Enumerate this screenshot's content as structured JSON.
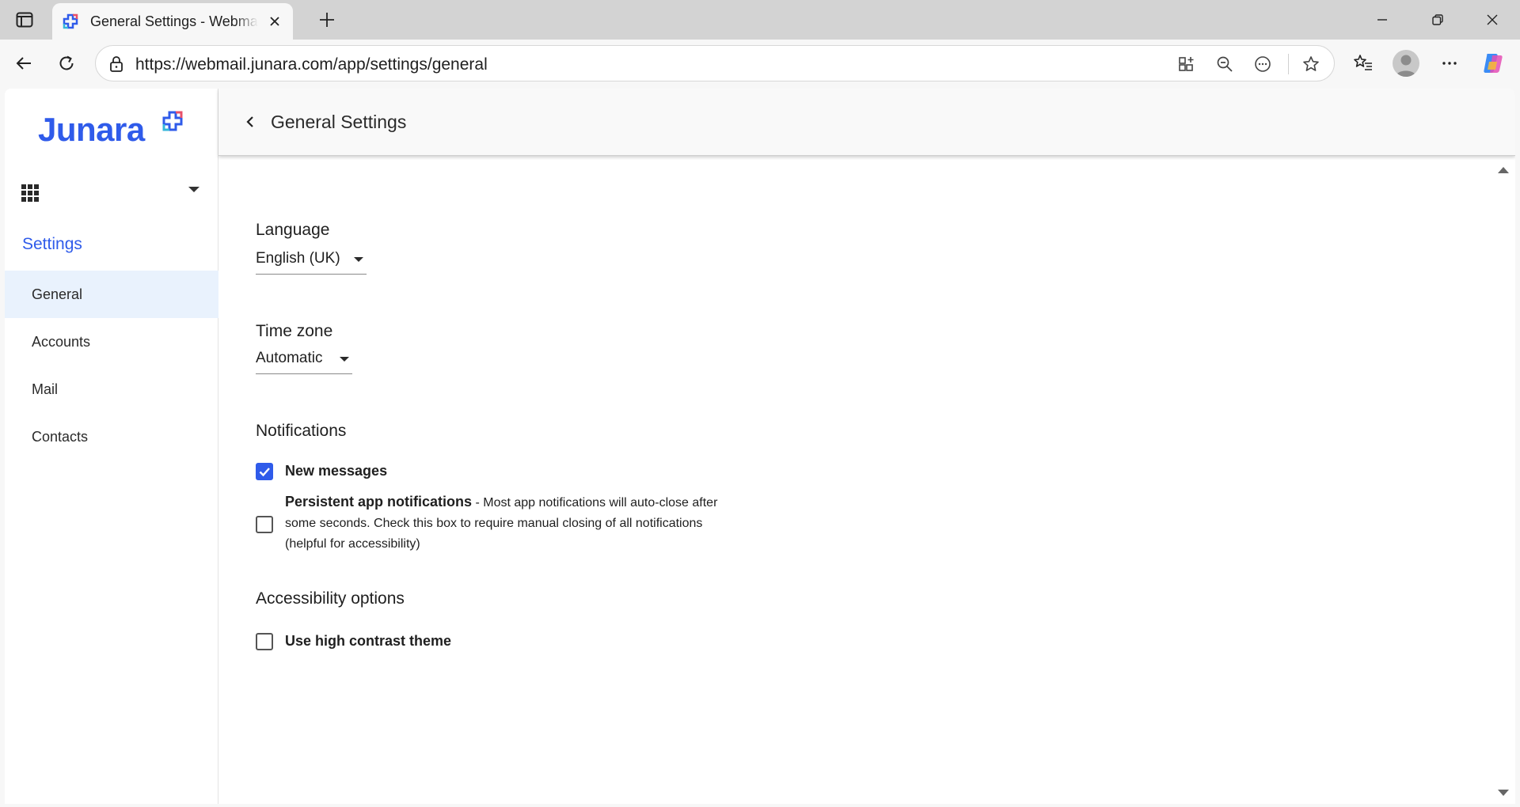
{
  "browser": {
    "tab_title": "General Settings - Webmail",
    "url": "https://webmail.junara.com/app/settings/general"
  },
  "sidebar": {
    "logo_text": "Junara",
    "settings_heading": "Settings",
    "items": [
      {
        "label": "General",
        "active": true
      },
      {
        "label": "Accounts",
        "active": false
      },
      {
        "label": "Mail",
        "active": false
      },
      {
        "label": "Contacts",
        "active": false
      }
    ]
  },
  "header": {
    "title": "General Settings"
  },
  "settings": {
    "language": {
      "label": "Language",
      "value": "English (UK)"
    },
    "timezone": {
      "label": "Time zone",
      "value": "Automatic"
    },
    "notifications": {
      "label": "Notifications",
      "new_messages": {
        "label": "New messages",
        "checked": true
      },
      "persistent": {
        "label": "Persistent app notifications",
        "description": " - Most app notifications will auto-close after some seconds. Check this box to require manual closing of all notifications (helpful for accessibility)",
        "checked": false
      }
    },
    "accessibility": {
      "label": "Accessibility options",
      "high_contrast": {
        "label": "Use high contrast theme",
        "checked": false
      }
    }
  },
  "colors": {
    "accent": "#2f5bea",
    "active_nav_bg": "#e9f2fd",
    "tabstrip_bg": "#d3d3d3"
  },
  "icons": {
    "tab_actions": "tab-actions-icon",
    "favicon": "junara-favicon-icon",
    "tab_close": "close-icon",
    "new_tab": "plus-icon",
    "back": "arrow-left-icon",
    "refresh": "refresh-icon",
    "lock": "lock-icon",
    "app_available": "app-add-icon",
    "zoom": "zoom-out-icon",
    "more_omni": "circle-ellipsis-icon",
    "favorite": "star-icon",
    "favorites": "favorites-list-icon",
    "profile": "avatar-icon",
    "more": "ellipsis-icon",
    "copilot": "copilot-icon"
  }
}
